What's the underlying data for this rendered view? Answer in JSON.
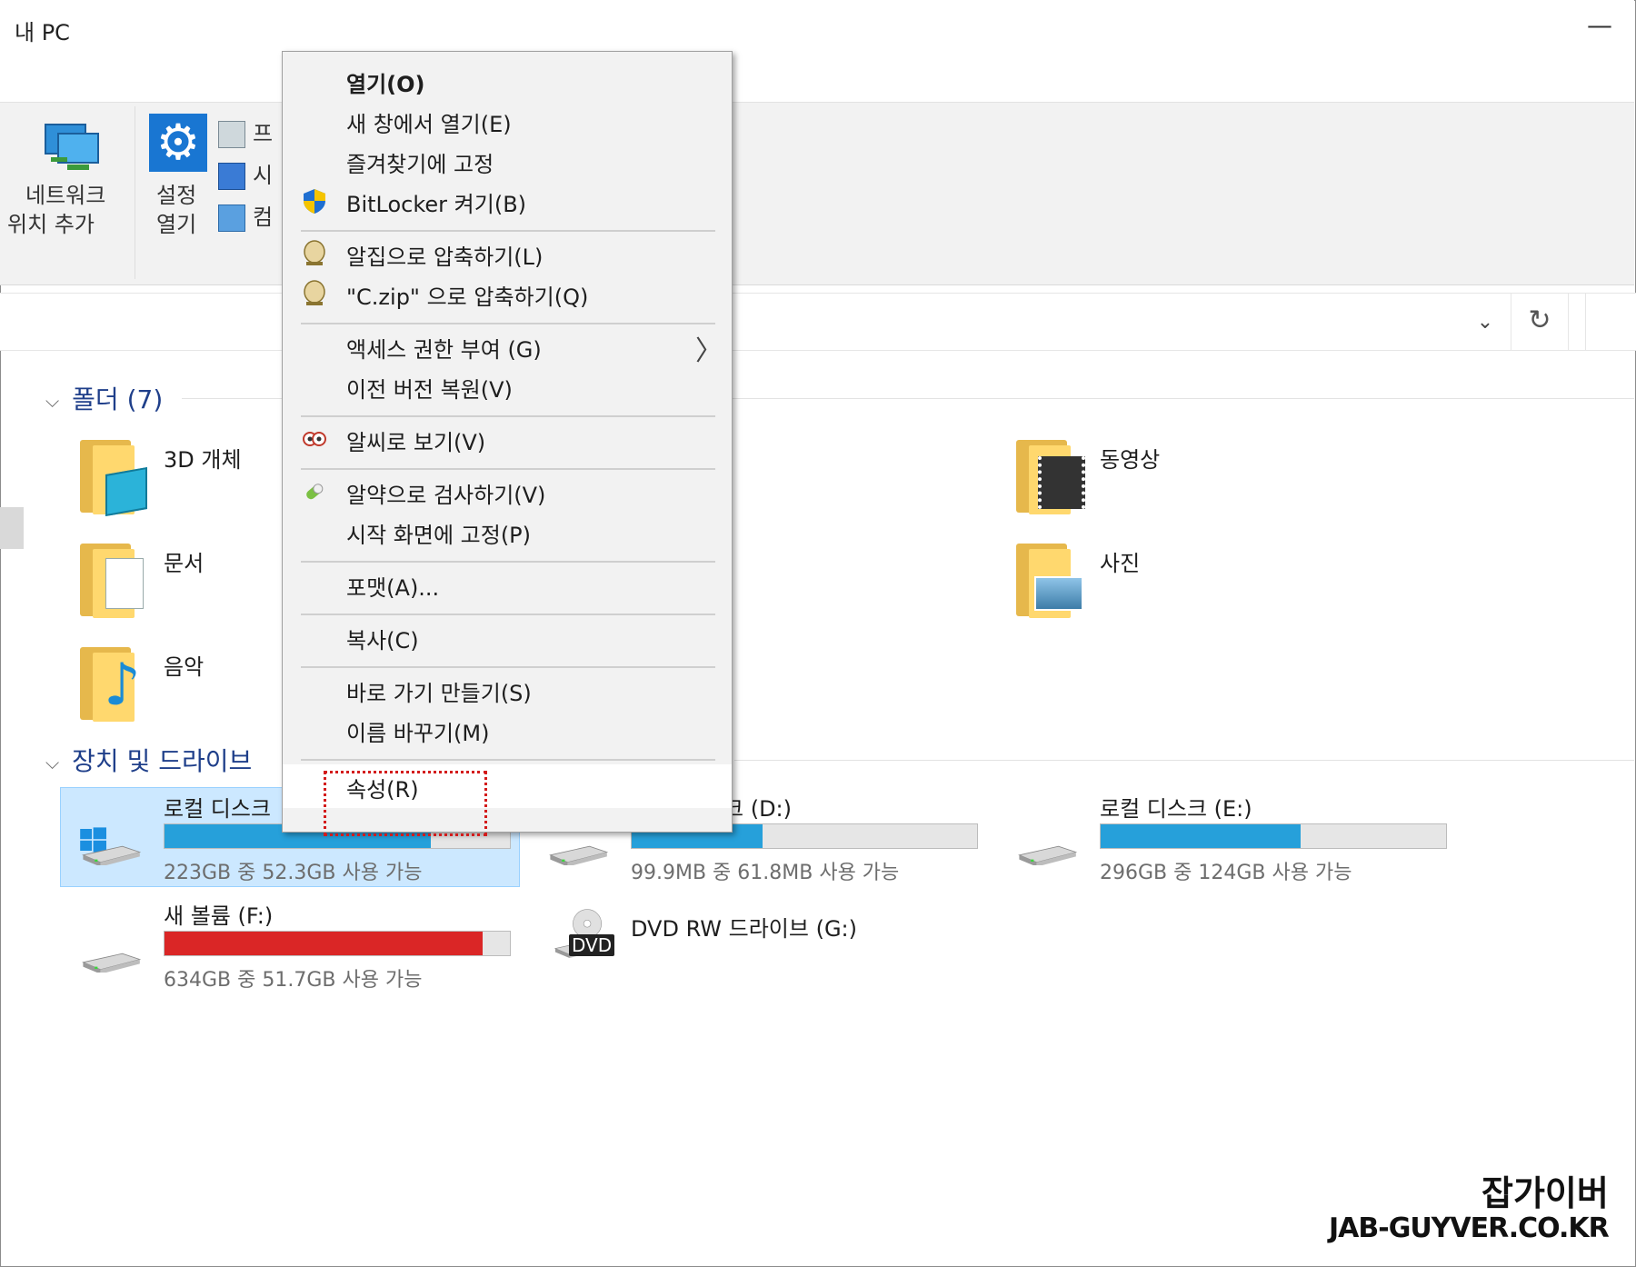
{
  "window": {
    "title": "내 PC",
    "minimize_glyph": "—"
  },
  "ribbon": {
    "network_label_1": "네트워크",
    "network_label_2": "위치 추가",
    "settings_label_1": "설정",
    "settings_label_2": "열기",
    "small_items": [
      "프",
      "시",
      "컴"
    ]
  },
  "address": {
    "dropdown_glyph": "⌄",
    "refresh_glyph": "↻"
  },
  "sections": {
    "folders": {
      "title": "폴더 (7)"
    },
    "drives": {
      "title": "장치 및 드라이브"
    }
  },
  "folders": [
    {
      "label": "3D 개체",
      "icon": "3d-objects-folder-icon"
    },
    {
      "label": "동영상",
      "icon": "videos-folder-icon"
    },
    {
      "label": "문서",
      "icon": "documents-folder-icon"
    },
    {
      "label": "사진",
      "icon": "pictures-folder-icon"
    },
    {
      "label": "음악",
      "icon": "music-folder-icon"
    }
  ],
  "drives": [
    {
      "name": "로컬 디스크",
      "info": "223GB 중 52.3GB 사용 가능",
      "used_fraction": 0.77,
      "bar_color": "#26a0da"
    },
    {
      "name": "크 (D:)",
      "info": "99.9MB 중 61.8MB 사용 가능",
      "used_fraction": 0.38,
      "bar_color": "#26a0da"
    },
    {
      "name": "로컬 디스크 (E:)",
      "info": "296GB 중 124GB 사용 가능",
      "used_fraction": 0.58,
      "bar_color": "#26a0da"
    },
    {
      "name": "새 볼륨 (F:)",
      "info": "634GB 중 51.7GB 사용 가능",
      "used_fraction": 0.92,
      "bar_color": "#da2626"
    },
    {
      "name": "DVD RW 드라이브 (G:)",
      "dvd_badge": "DVD"
    }
  ],
  "context_menu": {
    "items": [
      {
        "label": "열기(O)",
        "bold": true
      },
      {
        "label": "새 창에서 열기(E)"
      },
      {
        "label": "즐겨찾기에 고정"
      },
      {
        "label": "BitLocker 켜기(B)",
        "icon": "shield-icon"
      },
      {
        "label": "알집으로 압축하기(L)",
        "icon": "alzip-icon"
      },
      {
        "label": "\"C.zip\" 으로 압축하기(Q)",
        "icon": "alzip-icon"
      },
      {
        "label": "액세스 권한 부여 (G)",
        "submenu": true
      },
      {
        "label": "이전 버전 복원(V)"
      },
      {
        "label": "알씨로 보기(V)",
        "icon": "alsee-icon"
      },
      {
        "label": "알약으로 검사하기(V)",
        "icon": "alyac-icon"
      },
      {
        "label": "시작 화면에 고정(P)"
      },
      {
        "label": "포맷(A)..."
      },
      {
        "label": "복사(C)"
      },
      {
        "label": "바로 가기 만들기(S)"
      },
      {
        "label": "이름 바꾸기(M)"
      },
      {
        "label": "속성(R)",
        "highlighted": true
      }
    ],
    "submenu_glyph": "〉"
  },
  "watermark": {
    "line1": "잡가이버",
    "line2": "JAB-GUYVER.CO.KR"
  },
  "colors": {
    "accent": "#26a0da",
    "danger": "#da2626",
    "selection": "#cce8ff",
    "highlight_box": "#d31b1b"
  }
}
